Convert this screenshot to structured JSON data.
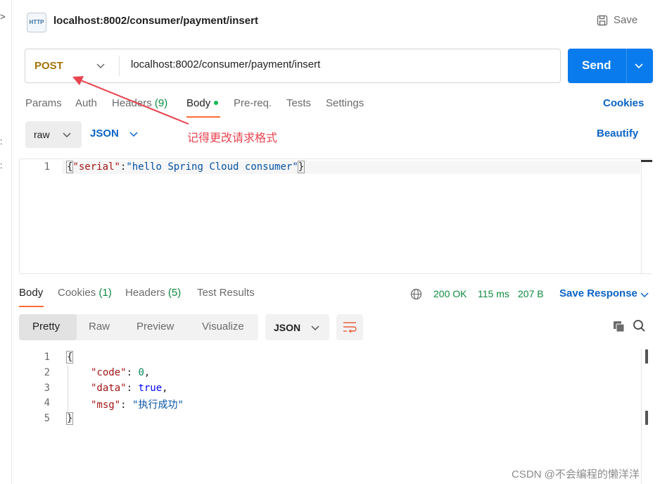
{
  "left_strip": {
    "marks": [
      ">",
      ":",
      ":"
    ]
  },
  "header": {
    "icon_text": "HTTP",
    "title": "localhost:8002/consumer/payment/insert",
    "save_label": "Save"
  },
  "request": {
    "method": "POST",
    "url": "localhost:8002/consumer/payment/insert",
    "send_label": "Send",
    "tabs": [
      {
        "label": "Params"
      },
      {
        "label": "Auth"
      },
      {
        "label": "Headers",
        "count": "(9)"
      },
      {
        "label": "Body"
      },
      {
        "label": "Pre-req."
      },
      {
        "label": "Tests"
      },
      {
        "label": "Settings"
      }
    ],
    "active_tab": "Body",
    "cookies_label": "Cookies",
    "body_mode": "raw",
    "body_format": "JSON",
    "beautify_label": "Beautify",
    "annotation": "记得更改请求格式",
    "body_lines": [
      {
        "num": "1",
        "open": "{",
        "key": "\"serial\"",
        "colon": ":",
        "value": "\"hello Spring Cloud consumer\"",
        "close": "}"
      }
    ]
  },
  "response": {
    "tabs": [
      {
        "label": "Body"
      },
      {
        "label": "Cookies",
        "count": "(1)"
      },
      {
        "label": "Headers",
        "count": "(5)"
      },
      {
        "label": "Test Results"
      }
    ],
    "status": "200 OK",
    "time": "115 ms",
    "size": "207 B",
    "save_response_label": "Save Response",
    "views": [
      "Pretty",
      "Raw",
      "Preview",
      "Visualize"
    ],
    "active_view": "Pretty",
    "format": "JSON",
    "lines": [
      {
        "num": "1",
        "text": "{"
      },
      {
        "num": "2",
        "key": "\"code\"",
        "value": "0",
        "trail": ","
      },
      {
        "num": "3",
        "key": "\"data\"",
        "value": "true",
        "trail": ","
      },
      {
        "num": "4",
        "key": "\"msg\"",
        "value": "\"执行成功\"",
        "trail": ""
      },
      {
        "num": "5",
        "text": "}"
      }
    ]
  },
  "watermark": "CSDN @不会编程的懒洋洋",
  "colors": {
    "accent": "#ff6c37",
    "send": "#097bed",
    "link": "#0b64c7",
    "method": "#a6740a",
    "annotation": "#e8434f",
    "status": "#0c8a3e"
  }
}
